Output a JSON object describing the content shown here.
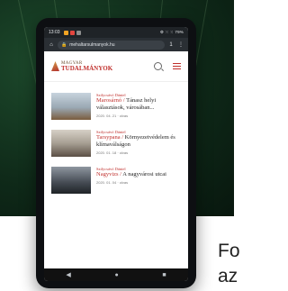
{
  "status": {
    "time": "13:03",
    "icon_colors": [
      "#f0a323",
      "#e4463f",
      "#8e8e8e"
    ],
    "right_text": "⚙ ⁙ ⁙ 79%"
  },
  "browser": {
    "url": "mehaltarsulmanyok.hu",
    "tabs_count": "1"
  },
  "site": {
    "logo_top": "MAGYAR",
    "logo_main": "TUDALMÁNYOK"
  },
  "articles": [
    {
      "category": "Szilycsávó Dániel",
      "title_highlight": "Marosárnó /",
      "title_rest": " Tánasz helyi választások, városában...",
      "date": "2020. 04. 21 · olvas"
    },
    {
      "category": "Szilycsávó Dániel",
      "title_highlight": "Tarsypana /",
      "title_rest": " Környezetvédelem és klímaválságon",
      "date": "2020. 01. 18 · olvas"
    },
    {
      "category": "Szilycsávó Dániel",
      "title_highlight": "Nagyvizs /",
      "title_rest": " A nagyvárosi utcai",
      "date": "2020. 01. 04 · olvas"
    }
  ],
  "caption": {
    "line1": "Fo",
    "line2": "az"
  }
}
